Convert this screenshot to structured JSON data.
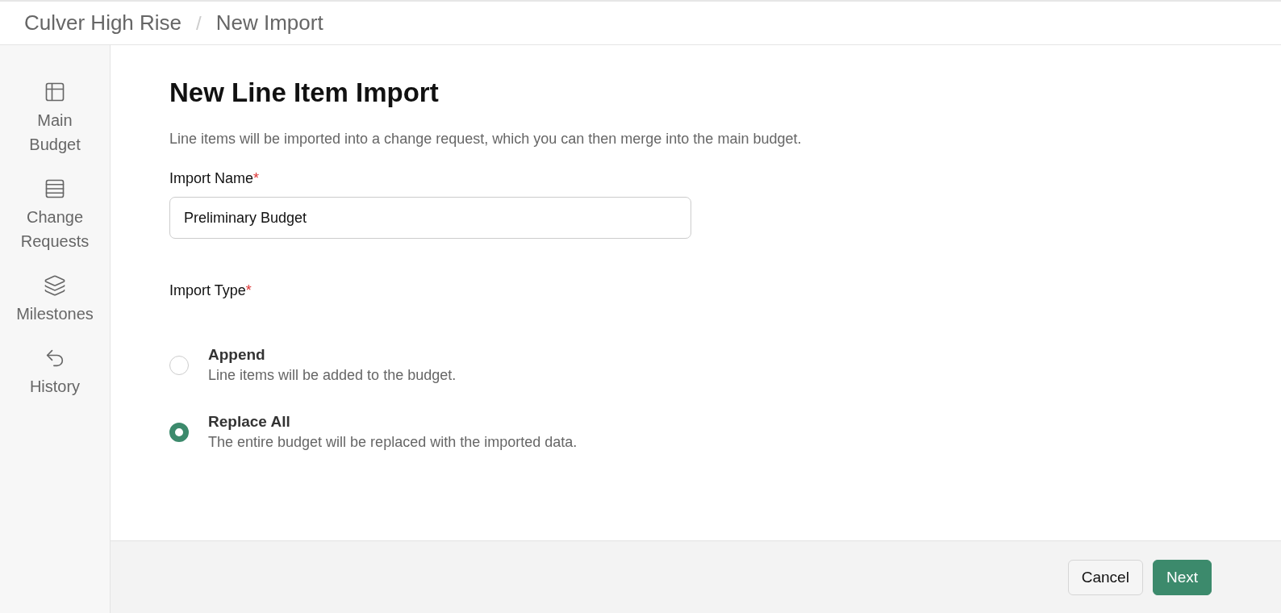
{
  "breadcrumb": [
    {
      "label": "Culver High Rise"
    },
    {
      "label": "New Import"
    }
  ],
  "breadcrumb_separator": "/",
  "sidebar": {
    "items": [
      {
        "label": "Main Budget"
      },
      {
        "label": "Change Requests"
      },
      {
        "label": "Milestones"
      },
      {
        "label": "History"
      }
    ]
  },
  "form": {
    "title": "New Line Item Import",
    "description": "Line items will be imported into a change request, which you can then merge into the main budget.",
    "name_field": {
      "label": "Import Name",
      "required_mark": "*",
      "value": "Preliminary Budget"
    },
    "type_field": {
      "label": "Import Type",
      "required_mark": "*",
      "options": [
        {
          "label": "Append",
          "description": "Line items will be added to the budget.",
          "selected": false
        },
        {
          "label": "Replace All",
          "description": "The entire budget will be replaced with the imported data.",
          "selected": true
        }
      ]
    }
  },
  "footer": {
    "buttons": [
      {
        "kind": "secondary",
        "label": "Cancel"
      },
      {
        "kind": "primary",
        "label": "Next"
      }
    ]
  }
}
